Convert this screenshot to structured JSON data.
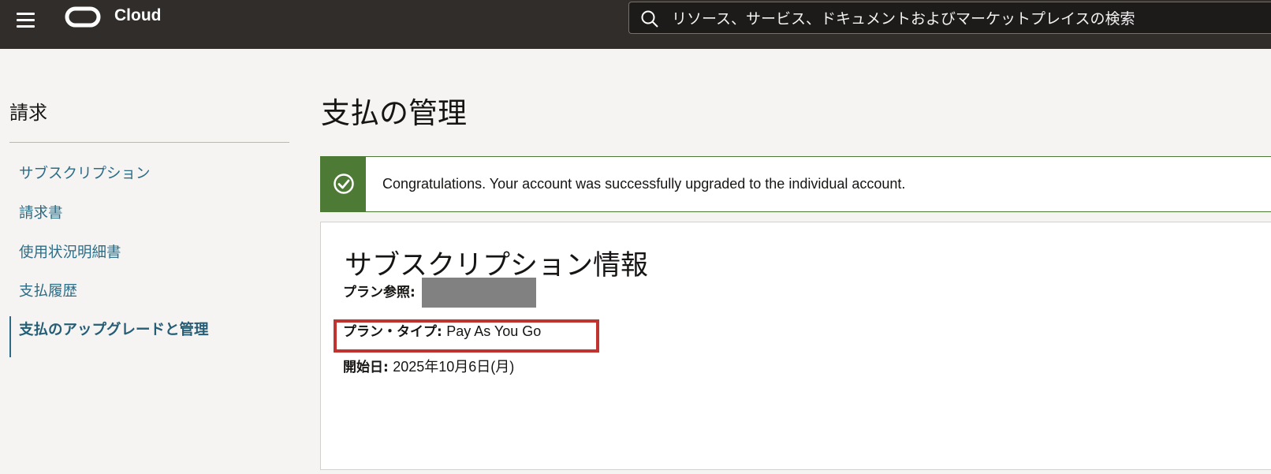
{
  "header": {
    "menu_icon": "hamburger-menu-icon",
    "logo_icon": "oracle-logo-icon",
    "brand": "Cloud",
    "search": {
      "icon": "search-icon",
      "placeholder": "リソース、サービス、ドキュメントおよびマーケットプレイスの検索"
    }
  },
  "sidebar": {
    "title": "請求",
    "items": [
      {
        "label": "サブスクリプション"
      },
      {
        "label": "請求書"
      },
      {
        "label": "使用状況明細書"
      },
      {
        "label": "支払履歴"
      },
      {
        "label": "支払のアップグレードと管理",
        "active": true
      }
    ]
  },
  "main": {
    "title": "支払の管理",
    "alert": {
      "icon": "check-circle-icon",
      "message": "Congratulations. Your account was successfully upgraded to the individual account."
    },
    "card": {
      "title": "サブスクリプション情報",
      "plan_ref": {
        "label": "プラン参照:"
      },
      "plan_type": {
        "label": "プラン・タイプ:",
        "value": "Pay As You Go"
      },
      "start_date": {
        "label": "開始日:",
        "value": "2025年10月6日(月)"
      }
    }
  },
  "colors": {
    "header_bg": "#312d2a",
    "success": "#4d7a34",
    "link": "#2c6c86",
    "highlight": "#c0332f"
  }
}
